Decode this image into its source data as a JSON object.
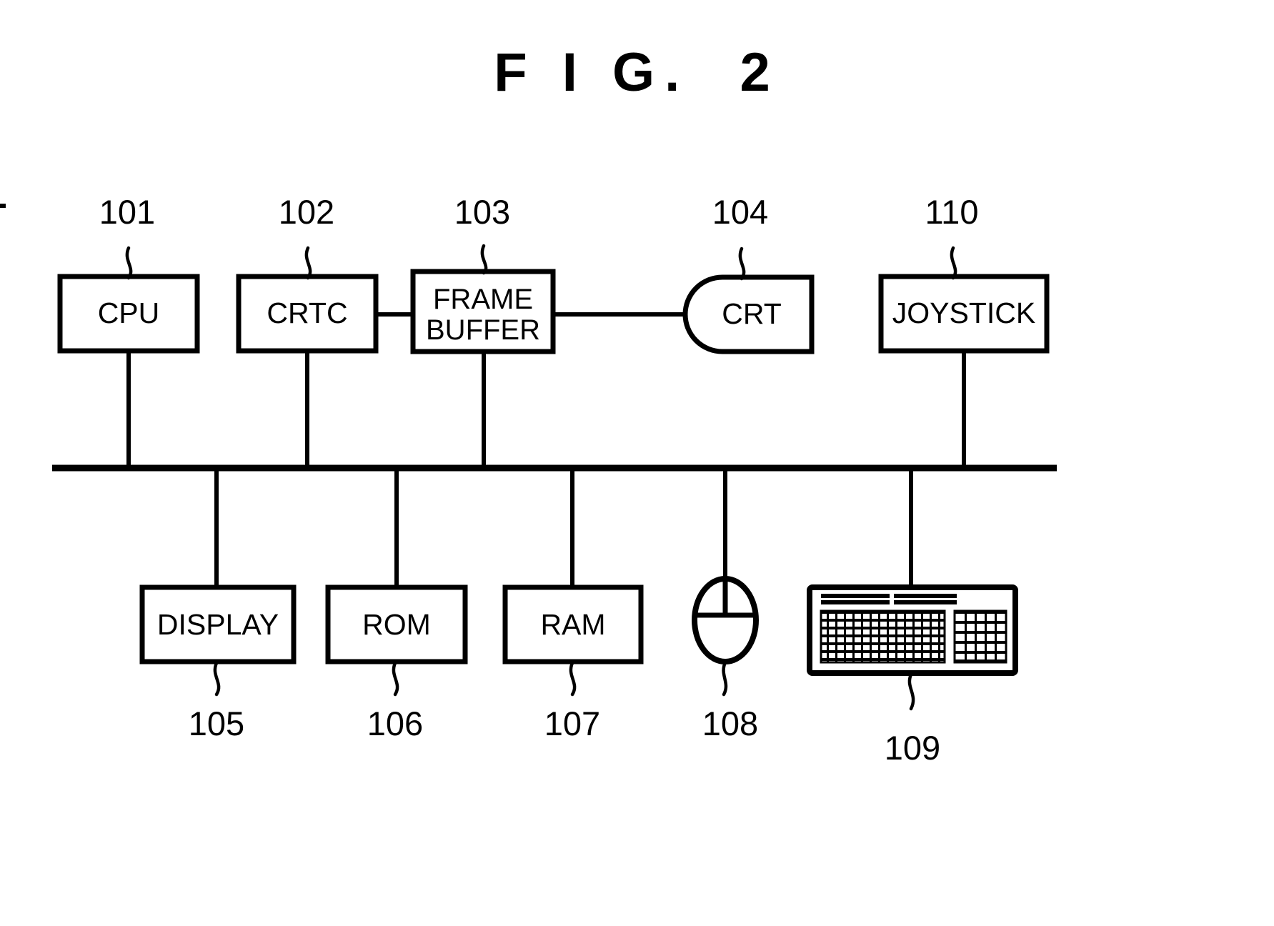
{
  "figure": {
    "title": "F I G.  2",
    "caption_prefix": "FIG.",
    "number": "2"
  },
  "top_row": [
    {
      "id": "cpu",
      "label": "CPU",
      "ref": "101"
    },
    {
      "id": "crtc",
      "label": "CRTC",
      "ref": "102"
    },
    {
      "id": "frame-buffer",
      "label": "FRAME",
      "label2": "BUFFER",
      "ref": "103"
    },
    {
      "id": "crt",
      "label": "CRT",
      "ref": "104"
    },
    {
      "id": "joystick",
      "label": "JOYSTICK",
      "ref": "110"
    }
  ],
  "bottom_row": [
    {
      "id": "display",
      "label": "DISPLAY",
      "ref": "105"
    },
    {
      "id": "rom",
      "label": "ROM",
      "ref": "106"
    },
    {
      "id": "ram",
      "label": "RAM",
      "ref": "107"
    },
    {
      "id": "mouse",
      "label": "",
      "ref": "108",
      "icon": "mouse-icon"
    },
    {
      "id": "keyboard",
      "label": "",
      "ref": "109",
      "icon": "keyboard-icon"
    }
  ],
  "bus": {
    "name": "system-bus"
  },
  "colors": {
    "ink": "#000000",
    "paper": "#ffffff"
  },
  "chart_data": {
    "type": "diagram",
    "title": "FIG. 2",
    "nodes": [
      {
        "ref": "101",
        "label": "CPU"
      },
      {
        "ref": "102",
        "label": "CRTC"
      },
      {
        "ref": "103",
        "label": "FRAME BUFFER"
      },
      {
        "ref": "104",
        "label": "CRT"
      },
      {
        "ref": "105",
        "label": "DISPLAY"
      },
      {
        "ref": "106",
        "label": "ROM"
      },
      {
        "ref": "107",
        "label": "RAM"
      },
      {
        "ref": "108",
        "label": "MOUSE"
      },
      {
        "ref": "109",
        "label": "KEYBOARD"
      },
      {
        "ref": "110",
        "label": "JOYSTICK"
      }
    ],
    "edges": [
      {
        "from": "102",
        "to": "103"
      },
      {
        "from": "103",
        "to": "104"
      },
      {
        "from": "101",
        "to": "bus"
      },
      {
        "from": "102",
        "to": "bus"
      },
      {
        "from": "103",
        "to": "bus"
      },
      {
        "from": "110",
        "to": "bus"
      },
      {
        "from": "bus",
        "to": "105"
      },
      {
        "from": "bus",
        "to": "106"
      },
      {
        "from": "bus",
        "to": "107"
      },
      {
        "from": "bus",
        "to": "108"
      },
      {
        "from": "bus",
        "to": "109"
      }
    ]
  }
}
